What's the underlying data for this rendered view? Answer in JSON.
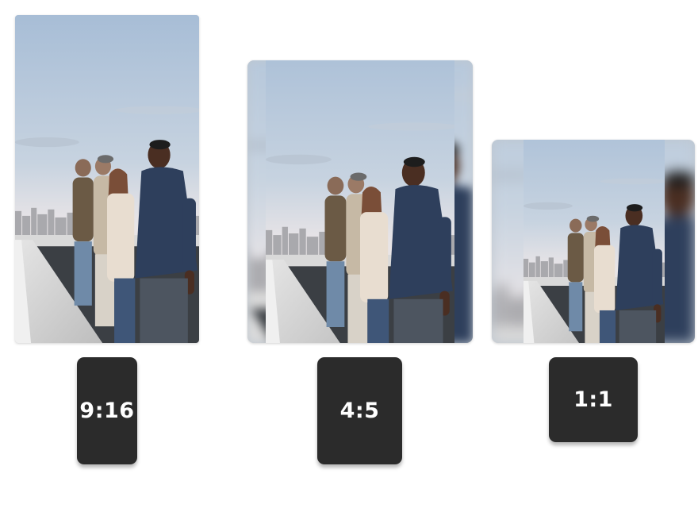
{
  "ratio_options": [
    {
      "id": "9-16",
      "label": "9:16"
    },
    {
      "id": "4-5",
      "label": "4:5"
    },
    {
      "id": "1-1",
      "label": "1:1"
    }
  ],
  "colors": {
    "button_bg": "#2b2b2b",
    "button_text": "#ffffff",
    "sky_top": "#a9bfd8",
    "sky_bottom": "#e3e2e4"
  },
  "preview_image": "rooftop-group-photo"
}
